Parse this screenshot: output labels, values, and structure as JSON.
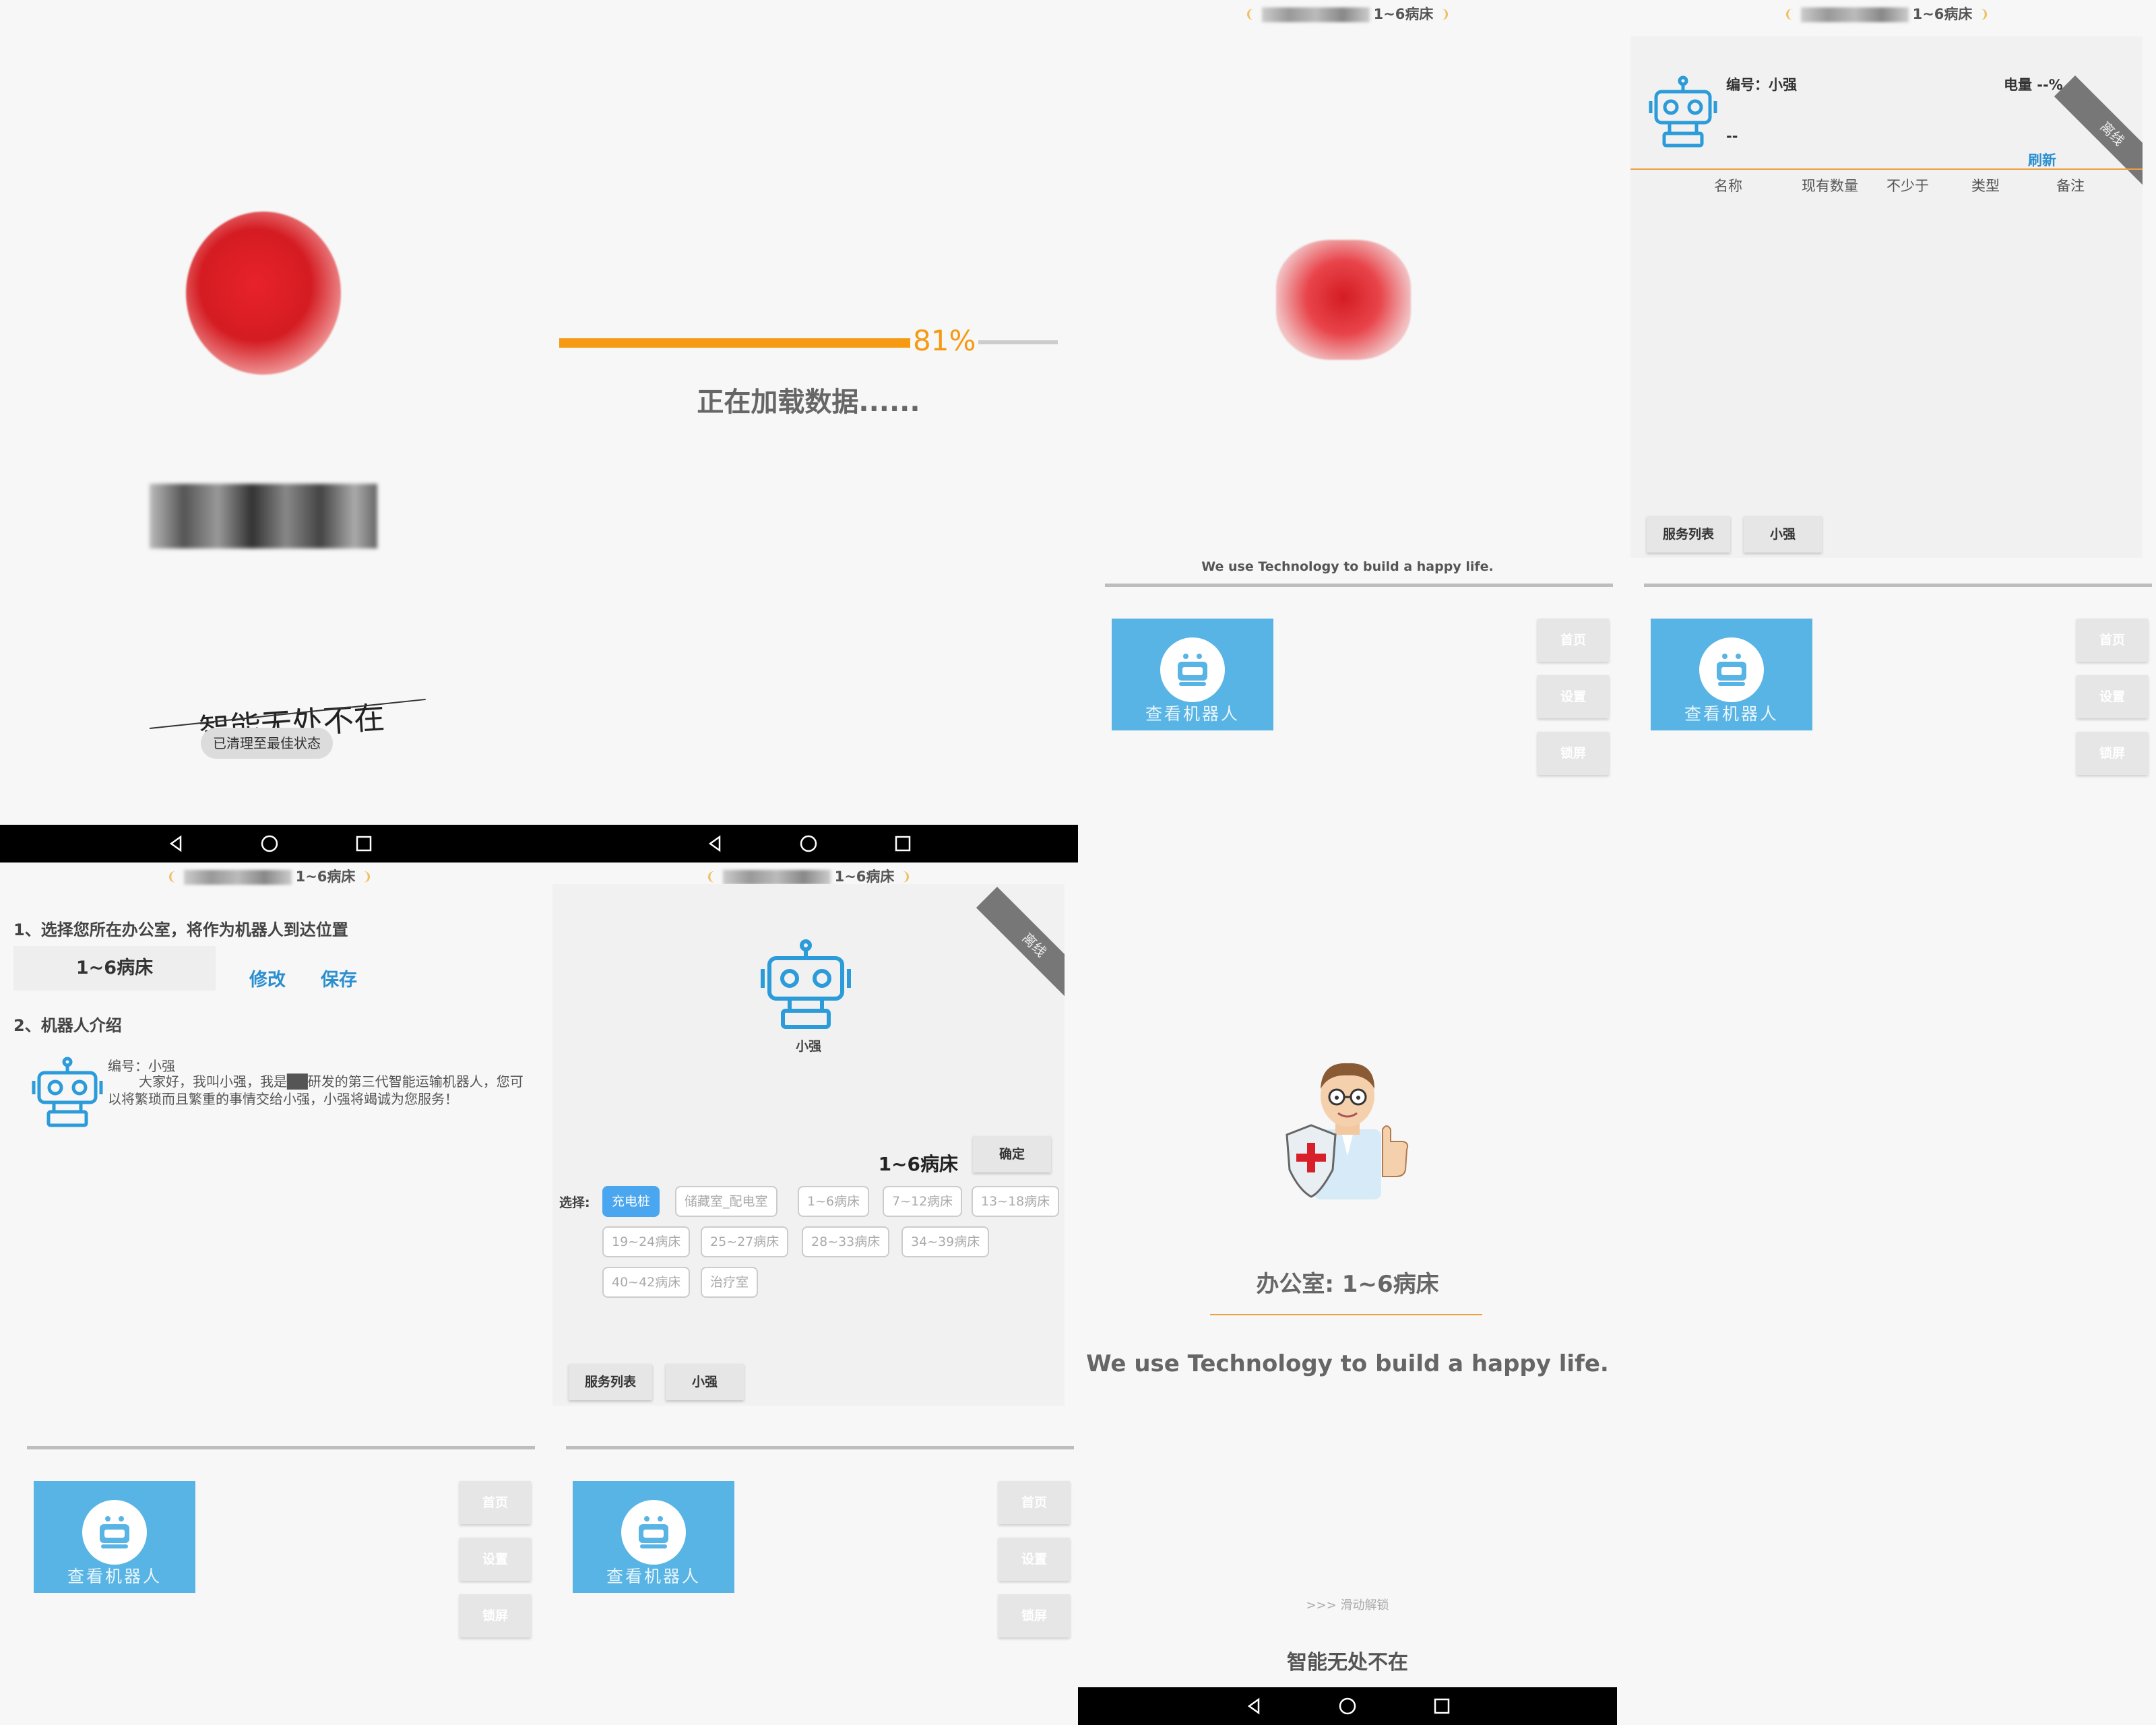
{
  "panel1": {
    "slogan": "智能无处不在",
    "toast": "已清理至最佳状态"
  },
  "panel2": {
    "progress_percent": 81,
    "progress_text": "81%",
    "loading_text": "正在加载数据......"
  },
  "header": {
    "location": "1~6病床"
  },
  "panel3": {
    "tagline": "We use Technology to build a happy life."
  },
  "common": {
    "view_robot_label": "查看机器人",
    "home_label": "首页",
    "settings_label": "设置",
    "lock_label": "锁屏",
    "service_list_label": "服务列表",
    "robot_tab_label": "小强"
  },
  "panel4": {
    "robot_id_label": "编号：小强",
    "battery_label": "电量 --%",
    "status_placeholder": "--",
    "offline_badge": "离线",
    "refresh_label": "刷新",
    "table_headers": [
      "名称",
      "现有数量",
      "不少于",
      "类型",
      "备注"
    ]
  },
  "panel5": {
    "section1_title": "1、选择您所在办公室，将作为机器人到达位置",
    "office_value": "1~6病床",
    "modify_label": "修改",
    "save_label": "保存",
    "section2_title": "2、机器人介绍",
    "robot_id_label": "编号：小强",
    "intro_text": "大家好，我叫小强，我是██研发的第三代智能运输机器人，您可以将繁琐而且繁重的事情交给小强，小强将竭诚为您服务！"
  },
  "panel6": {
    "offline_badge": "离线",
    "robot_name": "小强",
    "selected_location": "1~6病床",
    "confirm_label": "确定",
    "select_label": "选择:",
    "chips": [
      "充电桩",
      "储藏室_配电室",
      "1~6病床",
      "7~12病床",
      "13~18病床",
      "19~24病床",
      "25~27病床",
      "28~33病床",
      "34~39病床",
      "40~42病床",
      "治疗室"
    ],
    "active_chip": "充电桩"
  },
  "panel7": {
    "office_text": "办公室: 1~6病床",
    "tagline": "We use Technology to build a happy life.",
    "unlock_hint": ">>> 滑动解锁",
    "slogan": "智能无处不在"
  },
  "colors": {
    "accent_blue": "#58b4e4",
    "progress_orange": "#f59a12",
    "link_blue": "#2b8fd0",
    "orange_line": "#f0a040"
  }
}
